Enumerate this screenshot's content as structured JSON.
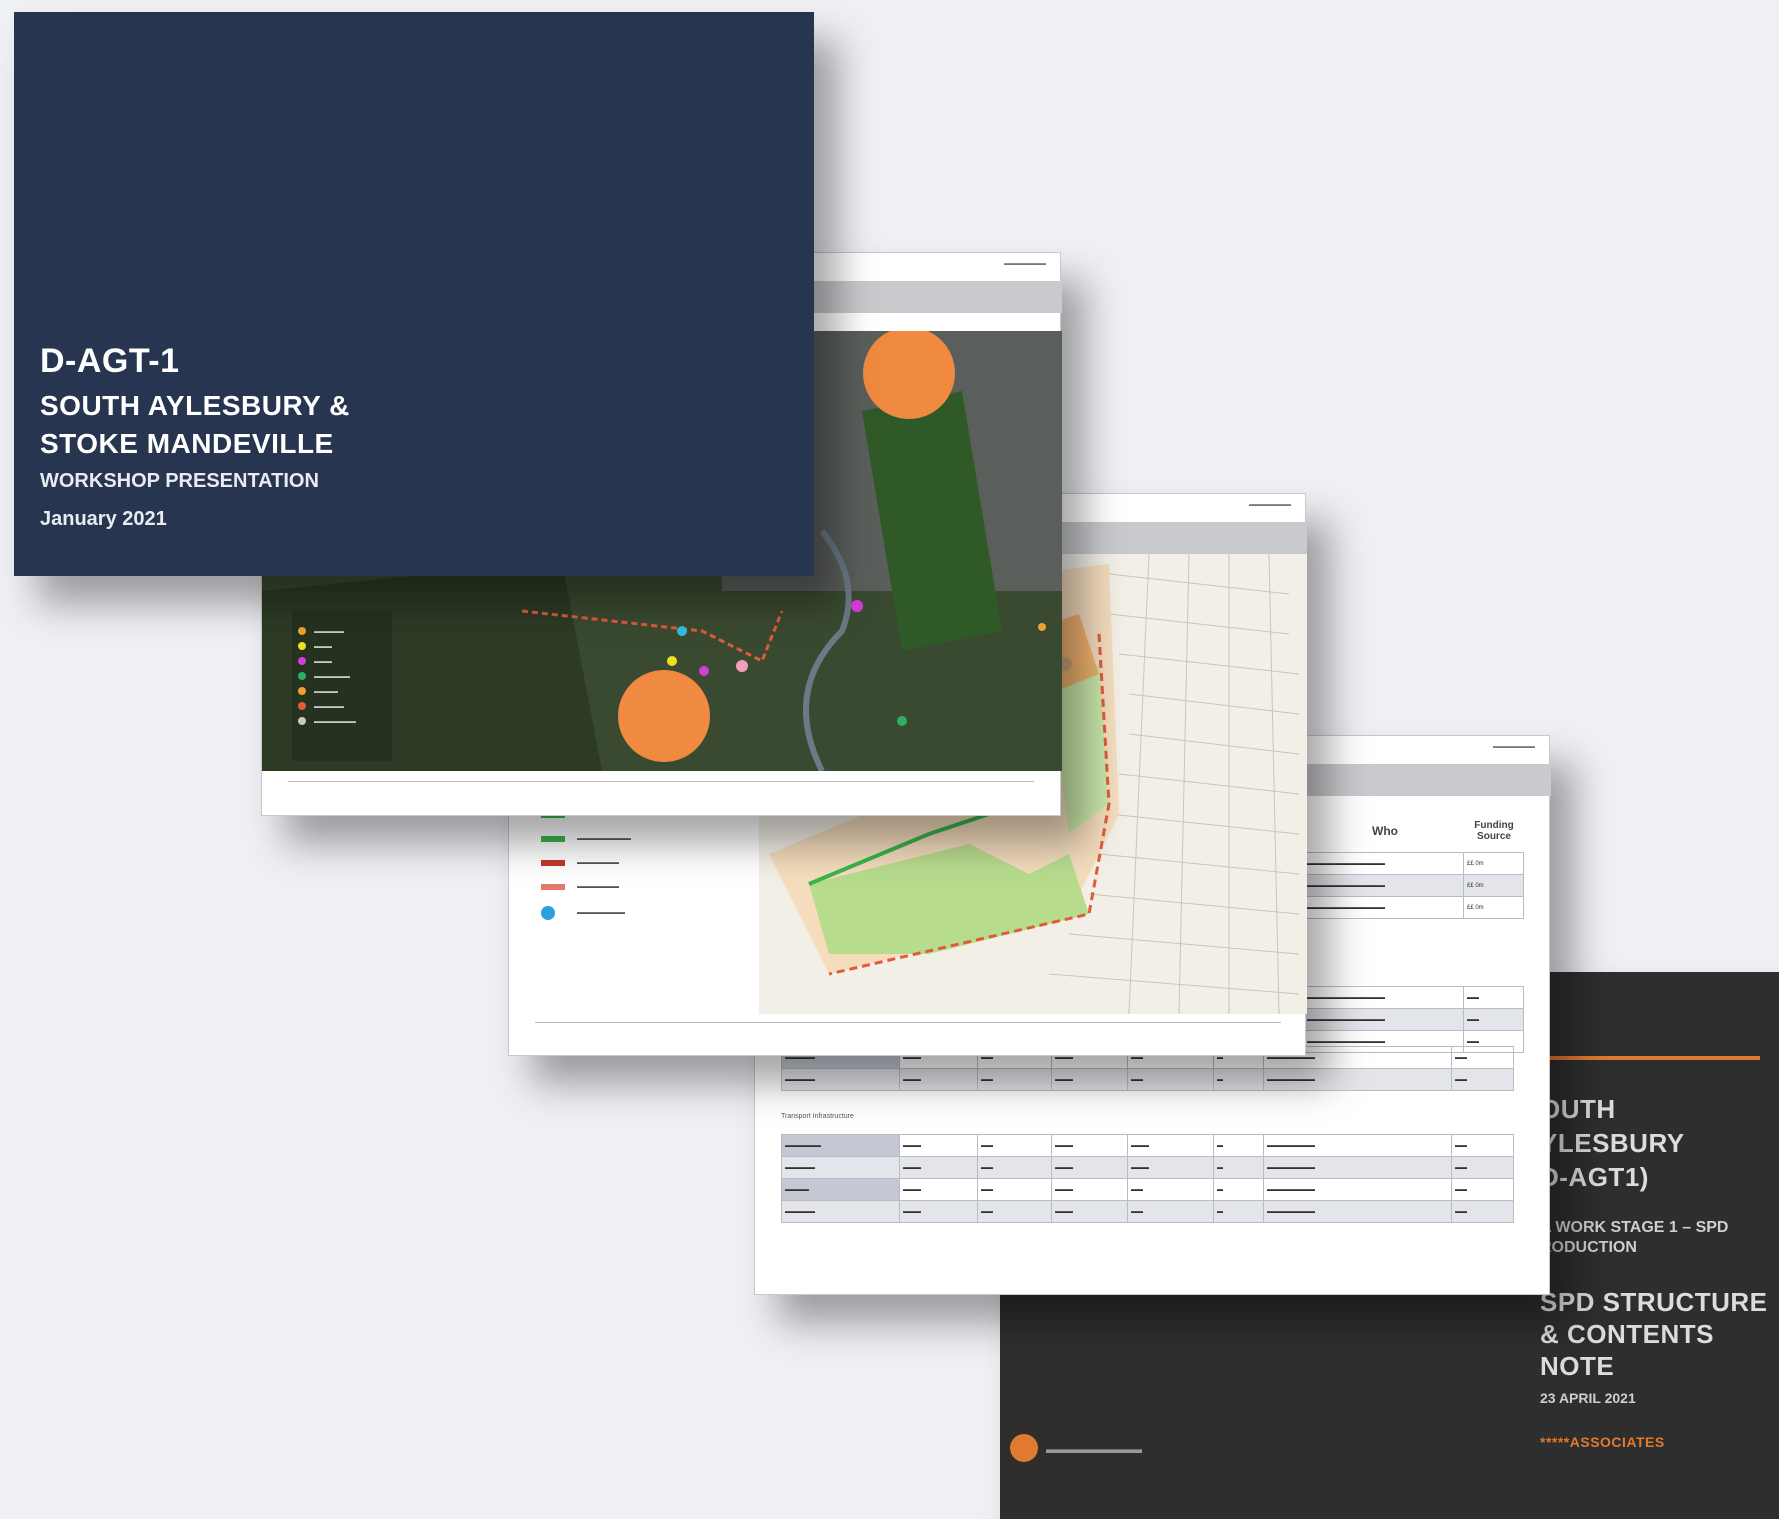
{
  "slide_title": {
    "code": "D-AGT-1",
    "line1": "SOUTH AYLESBURY &",
    "line2": "STOKE MANDEVILLE",
    "subtitle": "WORKSHOP PRESENTATION",
    "date": "January 2021"
  },
  "slide_spd": {
    "site": [
      "OUTH",
      "YLESBURY",
      "D-AGT1)"
    ],
    "stage": [
      "A WORK STAGE 1 – SPD",
      "RODUCTION"
    ],
    "note": [
      "SPD STRUCTURE",
      "& CONTENTS",
      "NOTE"
    ],
    "date": "23 APRIL 2021",
    "brand": "*****ASSOCIATES"
  },
  "slide_table": {
    "col_who": "Who",
    "col_funding": "Funding Source",
    "section_label": "Transport Infrastructure",
    "rows_top": [
      [
        "",
        "",
        "",
        "",
        "",
        "",
        "",
        "££ 0m"
      ],
      [
        "",
        "",
        "",
        "",
        "",
        "",
        "",
        "££ 0m"
      ],
      [
        "",
        "",
        "",
        "",
        "",
        "",
        "",
        "££ 0m"
      ]
    ]
  },
  "colors": {
    "navy": "#273550",
    "dark": "#2e2e2e",
    "orange": "#e07a2e",
    "aerial_green": "#3a4a30",
    "site_orange": "#f08a40"
  }
}
